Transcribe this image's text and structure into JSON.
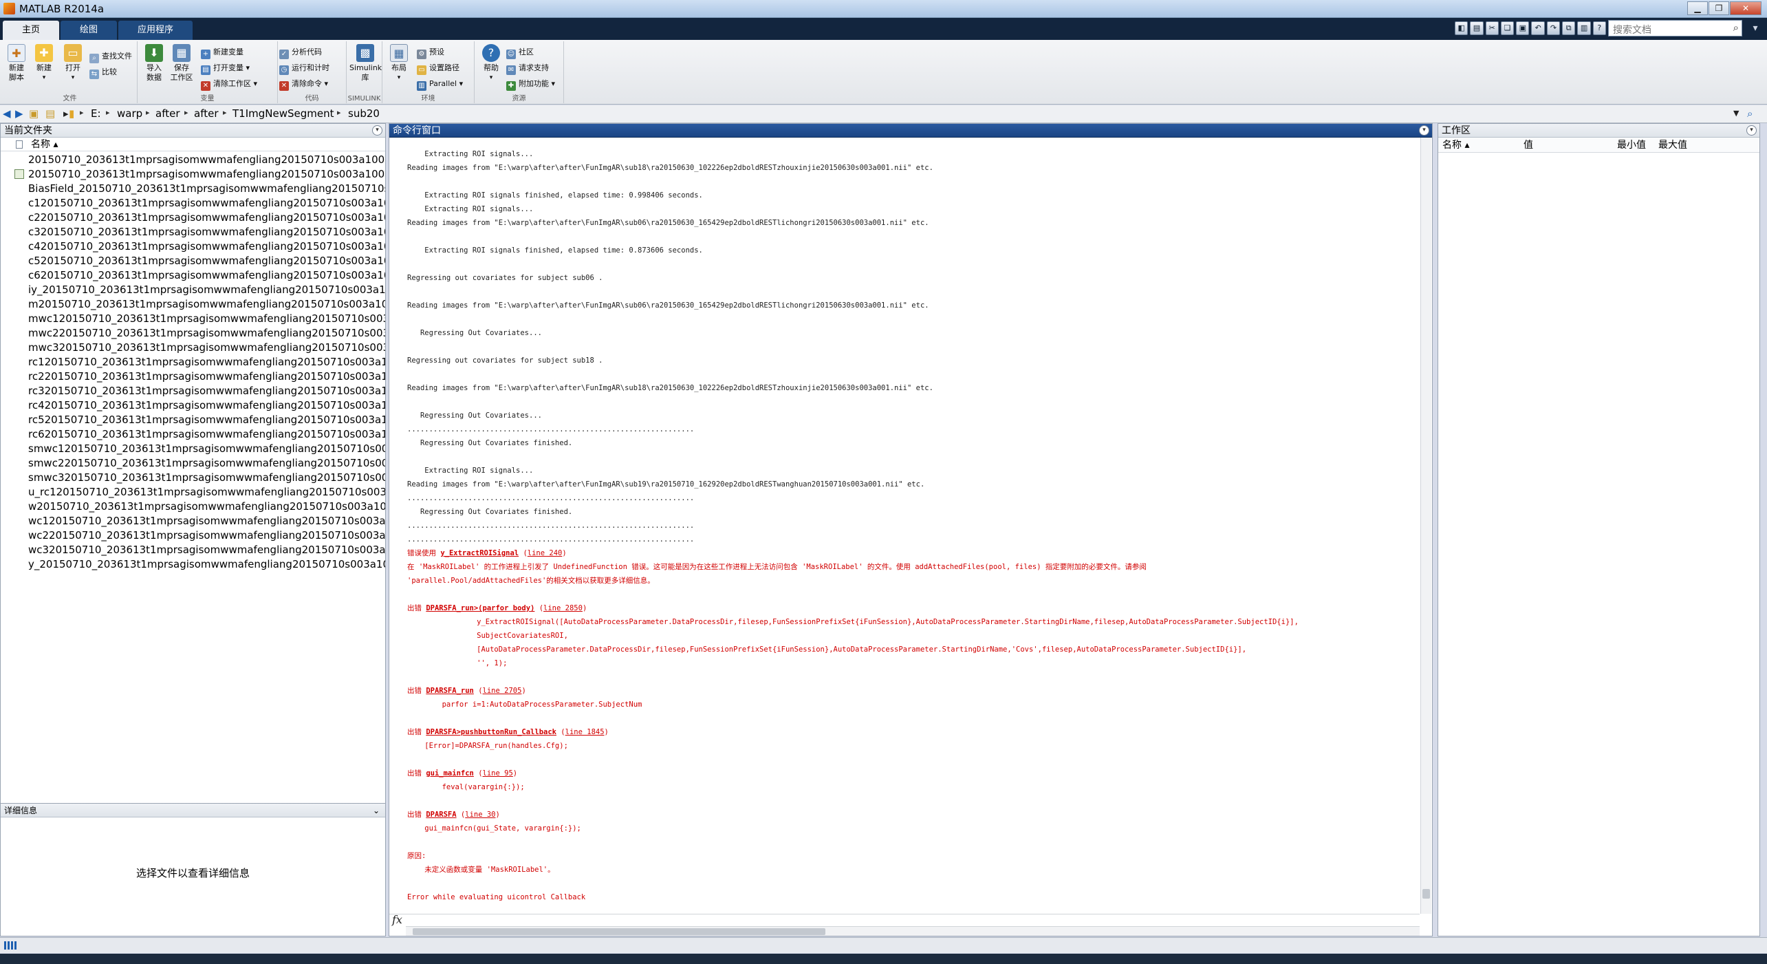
{
  "window": {
    "title": "MATLAB R2014a"
  },
  "ribbon_tabs": [
    {
      "label": "主页"
    },
    {
      "label": "绘图"
    },
    {
      "label": "应用程序"
    }
  ],
  "search": {
    "placeholder": "搜索文档"
  },
  "ribbon": {
    "file": {
      "label": "文件",
      "new_script": "新建\n脚本",
      "new": "新建",
      "open": "打开",
      "find_files": "查找文件",
      "compare": "比较"
    },
    "variable": {
      "label": "变量",
      "import": "导入\n数据",
      "save_ws": "保存\n工作区",
      "new_var": "新建变量",
      "open_var": "打开变量",
      "clear_ws": "清除工作区"
    },
    "code": {
      "label": "代码",
      "analyze": "分析代码",
      "run_time": "运行和计时",
      "clear_cmd": "清除命令"
    },
    "simulink": {
      "label": "SIMULINK",
      "lib": "Simulink\n库"
    },
    "environment": {
      "label": "环境",
      "layout": "布局",
      "prefs": "预设",
      "set_path": "设置路径",
      "parallel": "Parallel"
    },
    "resources": {
      "label": "资源",
      "help": "帮助",
      "community": "社区",
      "support": "请求支持",
      "addons": "附加功能"
    }
  },
  "address": {
    "crumbs": [
      "E:",
      "warp",
      "after",
      "after",
      "T1ImgNewSegment",
      "sub20"
    ]
  },
  "files_panel": {
    "title": "当前文件夹",
    "col_name": "名称 ▴",
    "files": [
      "20150710_203613t1mprsagisomwwmafengliang20150710s003a1001...",
      "20150710_203613t1mprsagisomwwmafengliang20150710s003a1001...",
      "BiasField_20150710_203613t1mprsagisomwwmafengliang20150710s...",
      "c120150710_203613t1mprsagisomwwmafengliang20150710s003a10...",
      "c220150710_203613t1mprsagisomwwmafengliang20150710s003a10...",
      "c320150710_203613t1mprsagisomwwmafengliang20150710s003a10...",
      "c420150710_203613t1mprsagisomwwmafengliang20150710s003a10...",
      "c520150710_203613t1mprsagisomwwmafengliang20150710s003a10...",
      "c620150710_203613t1mprsagisomwwmafengliang20150710s003a10...",
      "iy_20150710_203613t1mprsagisomwwmafengliang20150710s003a10...",
      "m20150710_203613t1mprsagisomwwmafengliang20150710s003a10...",
      "mwc120150710_203613t1mprsagisomwwmafengliang20150710s003...",
      "mwc220150710_203613t1mprsagisomwwmafengliang20150710s003...",
      "mwc320150710_203613t1mprsagisomwwmafengliang20150710s003...",
      "rc120150710_203613t1mprsagisomwwmafengliang20150710s003a1...",
      "rc220150710_203613t1mprsagisomwwmafengliang20150710s003a1...",
      "rc320150710_203613t1mprsagisomwwmafengliang20150710s003a1...",
      "rc420150710_203613t1mprsagisomwwmafengliang20150710s003a1...",
      "rc520150710_203613t1mprsagisomwwmafengliang20150710s003a1...",
      "rc620150710_203613t1mprsagisomwwmafengliang20150710s003a1...",
      "smwc120150710_203613t1mprsagisomwwmafengliang20150710s00...",
      "smwc220150710_203613t1mprsagisomwwmafengliang20150710s00...",
      "smwc320150710_203613t1mprsagisomwwmafengliang20150710s00...",
      "u_rc120150710_203613t1mprsagisomwwmafengliang20150710s003a...",
      "w20150710_203613t1mprsagisomwwmafengliang20150710s003a100...",
      "wc120150710_203613t1mprsagisomwwmafengliang20150710s003a1...",
      "wc220150710_203613t1mprsagisomwwmafengliang20150710s003a1...",
      "wc320150710_203613t1mprsagisomwwmafengliang20150710s003a1...",
      "y_20150710_203613t1mprsagisomwwmafengliang20150710s003a10..."
    ]
  },
  "details_panel": {
    "title": "详细信息",
    "message": "选择文件以查看详细信息"
  },
  "command_window": {
    "title": "命令行窗口",
    "lines": [
      {
        "t": "    Extracting ROI signals...",
        "c": "n"
      },
      {
        "t": "Reading images from \"E:\\warp\\after\\after\\FunImgAR\\sub18\\ra20150630_102226ep2dboldRESTzhouxinjie20150630s003a001.nii\" etc.",
        "c": "n"
      },
      {
        "t": "",
        "c": "n"
      },
      {
        "t": "    Extracting ROI signals finished, elapsed time: 0.998406 seconds.",
        "c": "n"
      },
      {
        "t": "    Extracting ROI signals...",
        "c": "n"
      },
      {
        "t": "Reading images from \"E:\\warp\\after\\after\\FunImgAR\\sub06\\ra20150630_165429ep2dboldRESTlichongri20150630s003a001.nii\" etc.",
        "c": "n"
      },
      {
        "t": "",
        "c": "n"
      },
      {
        "t": "    Extracting ROI signals finished, elapsed time: 0.873606 seconds.",
        "c": "n"
      },
      {
        "t": "",
        "c": "n"
      },
      {
        "t": "Regressing out covariates for subject sub06 .",
        "c": "n"
      },
      {
        "t": "",
        "c": "n"
      },
      {
        "t": "Reading images from \"E:\\warp\\after\\after\\FunImgAR\\sub06\\ra20150630_165429ep2dboldRESTlichongri20150630s003a001.nii\" etc.",
        "c": "n"
      },
      {
        "t": "",
        "c": "n"
      },
      {
        "t": "   Regressing Out Covariates...",
        "c": "n"
      },
      {
        "t": "",
        "c": "n"
      },
      {
        "t": "Regressing out covariates for subject sub18 .",
        "c": "n"
      },
      {
        "t": "",
        "c": "n"
      },
      {
        "t": "Reading images from \"E:\\warp\\after\\after\\FunImgAR\\sub18\\ra20150630_102226ep2dboldRESTzhouxinjie20150630s003a001.nii\" etc.",
        "c": "n"
      },
      {
        "t": "",
        "c": "n"
      },
      {
        "t": "   Regressing Out Covariates...",
        "c": "n"
      },
      {
        "t": "..................................................................",
        "c": "n"
      },
      {
        "t": "   Regressing Out Covariates finished.",
        "c": "n"
      },
      {
        "t": "",
        "c": "n"
      },
      {
        "t": "    Extracting ROI signals...",
        "c": "n"
      },
      {
        "t": "Reading images from \"E:\\warp\\after\\after\\FunImgAR\\sub19\\ra20150710_162920ep2dboldRESTwanghuan20150710s003a001.nii\" etc.",
        "c": "n"
      },
      {
        "t": "..................................................................",
        "c": "n"
      },
      {
        "t": "   Regressing Out Covariates finished.",
        "c": "n"
      },
      {
        "t": "..................................................................",
        "c": "n"
      },
      {
        "t": "..................................................................",
        "c": "n"
      },
      {
        "p": "错误使用 ",
        "f": "y_ExtractROISignal",
        "s": " (",
        "l": "line 240",
        "e": ")",
        "c": "e"
      },
      {
        "t": "在 'MaskROILabel' 的工作进程上引发了 UndefinedFunction 错误。这可能是因为在这些工作进程上无法访问包含 'MaskROILabel' 的文件。使用 addAttachedFiles(pool, files) 指定要附加的必要文件。请参阅",
        "c": "e"
      },
      {
        "t": "'parallel.Pool/addAttachedFiles'的相关文档以获取更多详细信息。",
        "c": "e"
      },
      {
        "t": "",
        "c": "n"
      },
      {
        "p": "出错 ",
        "f": "DPARSFA_run>(parfor body)",
        "s": " (",
        "l": "line 2850",
        "e": ")",
        "c": "e"
      },
      {
        "t": "                y_ExtractROISignal([AutoDataProcessParameter.DataProcessDir,filesep,FunSessionPrefixSet{iFunSession},AutoDataProcessParameter.StartingDirName,filesep,AutoDataProcessParameter.SubjectID{i}],",
        "c": "e"
      },
      {
        "t": "                SubjectCovariatesROI,",
        "c": "e"
      },
      {
        "t": "                [AutoDataProcessParameter.DataProcessDir,filesep,FunSessionPrefixSet{iFunSession},AutoDataProcessParameter.StartingDirName,'Covs',filesep,AutoDataProcessParameter.SubjectID{i}],",
        "c": "e"
      },
      {
        "t": "                '', 1);",
        "c": "e"
      },
      {
        "t": "",
        "c": "n"
      },
      {
        "p": "出错 ",
        "f": "DPARSFA_run",
        "s": " (",
        "l": "line 2705",
        "e": ")",
        "c": "e"
      },
      {
        "t": "        parfor i=1:AutoDataProcessParameter.SubjectNum",
        "c": "e"
      },
      {
        "t": "",
        "c": "n"
      },
      {
        "p": "出错 ",
        "f": "DPARSFA>pushbuttonRun_Callback",
        "s": " (",
        "l": "line 1845",
        "e": ")",
        "c": "e"
      },
      {
        "t": "    [Error]=DPARSFA_run(handles.Cfg);",
        "c": "e"
      },
      {
        "t": "",
        "c": "n"
      },
      {
        "p": "出错 ",
        "f": "gui_mainfcn",
        "s": " (",
        "l": "line 95",
        "e": ")",
        "c": "e"
      },
      {
        "t": "        feval(varargin{:});",
        "c": "e"
      },
      {
        "t": "",
        "c": "n"
      },
      {
        "p": "出错 ",
        "f": "DPARSFA",
        "s": " (",
        "l": "line 30",
        "e": ")",
        "c": "e"
      },
      {
        "t": "    gui_mainfcn(gui_State, varargin{:});",
        "c": "e"
      },
      {
        "t": "",
        "c": "n"
      },
      {
        "t": "原因:",
        "c": "e"
      },
      {
        "t": "    未定义函数或变量 'MaskROILabel'。",
        "c": "e"
      },
      {
        "t": "",
        "c": "n"
      },
      {
        "t": "Error while evaluating uicontrol Callback",
        "c": "e"
      }
    ],
    "prompt_symbol": "fx"
  },
  "workspace": {
    "title": "工作区",
    "col_name": "名称 ▴",
    "col_value": "值",
    "col_min": "最小值",
    "col_max": "最大值"
  }
}
